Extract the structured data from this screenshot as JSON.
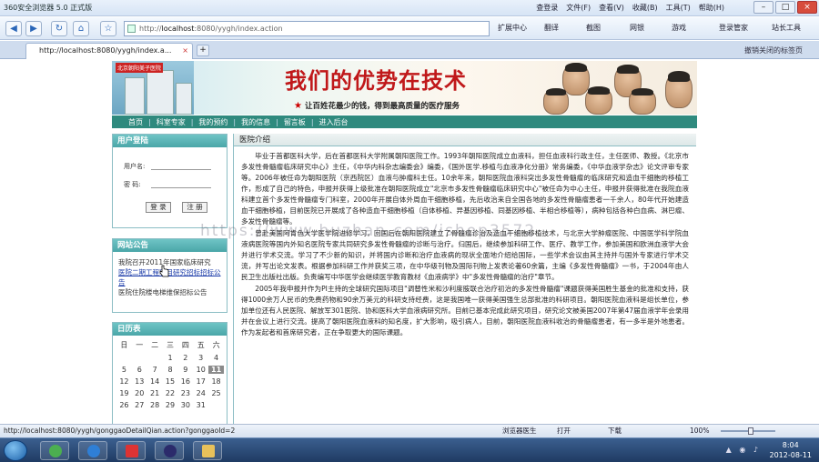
{
  "browser": {
    "title": "360安全浏览器 5.0 正式版",
    "menu": [
      "查登录",
      "文件(F)",
      "查看(V)",
      "收藏(B)",
      "工具(T)",
      "帮助(H)"
    ],
    "address": {
      "prefix": "http://",
      "host": "localhost",
      "rest": ":8080/yygh/index.action"
    },
    "tools": [
      "扩展中心",
      "翻译",
      "截图",
      "网银",
      "游戏",
      "登录管家",
      "站长工具"
    ],
    "tab_label": "http://localhost:8080/yygh/index.a...",
    "reopen_label": "撤销关闭的标签页",
    "status_url": "http://localhost:8080/yygh/gonggaoDetailQian.action?gonggaoId=2",
    "status_tools": [
      "浏览器医生",
      "下载",
      "100%"
    ],
    "status_open": "打开"
  },
  "site": {
    "hospital_sign": "北京朝阳美子医院",
    "banner_title": "我们的优势在技术",
    "banner_slogan": "让百姓花最少的钱，得到最高质量的医疗服务",
    "nav": [
      "首页",
      "科室专家",
      "我的预约",
      "我的信息",
      "留言板",
      "进入后台"
    ]
  },
  "login": {
    "header": "用户登陆",
    "username_label": "用户名:",
    "password_label": "密 码:",
    "login_button": "登 录",
    "register_button": "注 册"
  },
  "notice": {
    "header": "网站公告",
    "items": [
      "我院召开2011年国家临床研究",
      "医院二期工程项目研究招标招标公告",
      "医院住院楼电梯维保招标公告"
    ]
  },
  "calendar": {
    "header": "日历表",
    "weekdays": [
      "日",
      "一",
      "二",
      "三",
      "四",
      "五",
      "六"
    ],
    "rows": [
      [
        "",
        "",
        "",
        "1",
        "2",
        "3",
        "4"
      ],
      [
        "5",
        "6",
        "7",
        "8",
        "9",
        "10",
        "11"
      ],
      [
        "12",
        "13",
        "14",
        "15",
        "16",
        "17",
        "18"
      ],
      [
        "19",
        "20",
        "21",
        "22",
        "23",
        "24",
        "25"
      ],
      [
        "26",
        "27",
        "28",
        "29",
        "30",
        "31",
        ""
      ]
    ],
    "today": "11"
  },
  "main": {
    "header": "医院介绍",
    "paragraphs": [
      "毕业于首都医科大学，后在首都医科大学附属朝阳医院工作。1993年朝阳医院成立血液科，担任血液科行政主任，主任医师、教授。《北京市多发性骨髓瘤临床研究中心》主任，《中华内科杂志编委会》编委，《国外医学.移植与血液净化分册》常务编委，《中华血液学杂志》论文评审专家等。2006年被任命为朝阳医院（京西院区）血液与肿瘤科主任。10余年来，朝阳医院血液科突出多发性骨髓瘤的临床研究和造血干细胞的移植工作，形成了自己的特色，申报并获得上级批准在朝阳医院成立\"北京市多发性骨髓瘤临床研究中心\"被任命为中心主任，申报并获得批准在我院血液科建立首个多发性骨髓瘤专门科室，2000年开展自体外周血干细胞移植，先后收治来自全国各地的多发性骨髓瘤患者一千余人，80年代开始建造血干细胞移植，目前医院已开展成了各种造血干细胞移植（自体移植、异基因移植、同基因移植、半相合移植等），病种包括各种白血病、淋巴瘤、多发性骨髓瘤等。",
      "曾赴美国阿肯色大学医学院进修学习，回国后在朝阳医院建立了骨髓瘤诊治及造血干细胞移植技术，与北京大学肿瘤医院、中国医学科学院血液病医院等国内外知名医院专家共同研究多发性骨髓瘤的诊断与治疗。归国后，继续参加科研工作、医疗、教学工作，参加美国和欧洲血液学大会并进行学术交流。学习了不少新的知识，并将国内诊断和治疗血液病的现状全面地介绍给国际，一些学术会议由其主持并与国外专家进行学术交流，并写出论文发表。根据参加科研工作并获奖三项，在中华级刊物及国际刊物上发表论著60余篇，主编《多发性骨髓瘤》一书，于2004年由人民卫生出版社出版。负责编写中华医学会继续医学教育教材《血液病学》中\"多发性骨髓瘤的治疗\"章节。",
      "2005年我申报并作为PI主持的全球研究国际项目\"调替性米和沙利度胺联合治疗初治的多发性骨髓瘤\"课题获得美国胜生基金的批准和支持，获得1000余万人民币的免费药物和90余万美元的科研支持经费，这是我国唯一获得美国强生总部批准的科研项目。朝阳医院血液科是组长单位，参加单位还有人民医院、解放军301医院、协和医科大学血液病研究所。目前已基本完成此研究项目，研究论文被美国2007年第47届血液学年会录用并在会议上进行交流。提高了朝阳医院血液科的知名度，扩大影响，吸引病人，目前，朝阳医院血液科收治的骨髓瘤患者，有一多半是外地患者。作为发起者和首席研究者，正在争取更大的国际课题。"
    ]
  },
  "watermark": "https://www.huzhan.com/ishop3572",
  "taskbar": {
    "time": "8:04",
    "date": "2012-08-11"
  }
}
